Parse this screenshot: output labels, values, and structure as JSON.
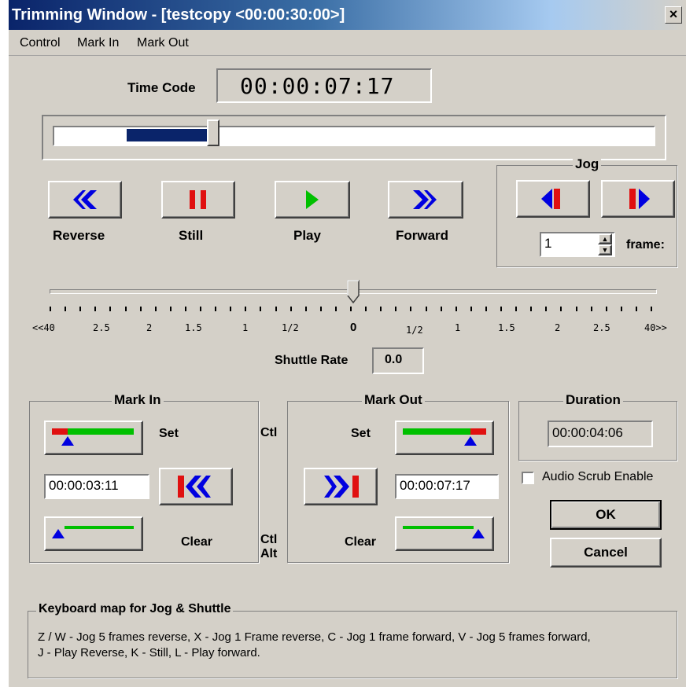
{
  "window": {
    "title": "Trimming Window - [testcopy <00:00:30:00>]",
    "close": "×"
  },
  "menu": [
    "Control",
    "Mark In",
    "Mark Out"
  ],
  "timecode": {
    "label": "Time Code",
    "value": "00:00:07:17"
  },
  "position_slider": {
    "fill_fraction": 0.245
  },
  "transport": {
    "reverse": "Reverse",
    "still": "Still",
    "play": "Play",
    "forward": "Forward"
  },
  "jog": {
    "title": "Jog",
    "frames_value": "1",
    "frames_label": "frame:"
  },
  "shuttle": {
    "scale": [
      "<<40",
      "2.5",
      "2",
      "1.5",
      "1",
      "1/2",
      "0",
      "1/2",
      "1",
      "1.5",
      "2",
      "2.5",
      "40>>"
    ],
    "rate_label": "Shuttle Rate",
    "rate_value": "0.0"
  },
  "mark_in": {
    "title": "Mark In",
    "set": "Set",
    "clear": "Clear",
    "value": "00:00:03:11"
  },
  "ctl_labels": {
    "top": "Ctl",
    "bottom_1": "Ctl",
    "bottom_2": "Alt"
  },
  "mark_out": {
    "title": "Mark Out",
    "set": "Set",
    "clear": "Clear",
    "value": "00:00:07:17"
  },
  "duration": {
    "title": "Duration",
    "value": "00:00:04:06"
  },
  "audio_scrub": {
    "label": "Audio Scrub Enable",
    "checked": false
  },
  "buttons": {
    "ok": "OK",
    "cancel": "Cancel"
  },
  "keyboard_map": {
    "title": "Keyboard map for Jog & Shuttle",
    "line1": "Z / W - Jog 5 frames reverse,  X - Jog 1 Frame reverse, C - Jog 1 frame forward, V - Jog 5 frames forward,",
    "line2": "J - Play Reverse, K - Still, L - Play forward."
  },
  "colors": {
    "blue": "#0000e0",
    "red": "#e01010",
    "green": "#00c000",
    "navy": "#0a246a"
  }
}
